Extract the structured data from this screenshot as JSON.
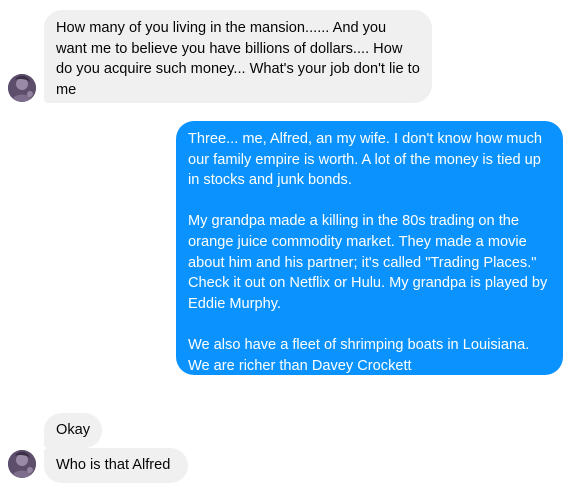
{
  "conversation": {
    "messages": [
      {
        "sender": "other",
        "text": "How many of you living in the mansion...... And you want me to believe you have billions of dollars.... How do you acquire such money... What's your job don't lie to me"
      },
      {
        "sender": "me",
        "text": "Three... me, Alfred, an my wife. I don't know how much our family empire is worth. A lot of the money is tied up in stocks and junk bonds.\n\nMy grandpa made a killing in the 80s trading on the orange juice commodity market. They made a movie about him and his partner; it's called \"Trading Places.\" Check it out on Netflix or Hulu. My grandpa is played by Eddie Murphy.\n\nWe also have a fleet of shrimping boats in Louisiana. We are richer than Davey Crockett"
      },
      {
        "sender": "other",
        "text": "Okay"
      },
      {
        "sender": "other",
        "text": "Who is that Alfred"
      }
    ]
  },
  "colors": {
    "incoming_bubble": "#f0f0f0",
    "outgoing_bubble": "#0a93ff",
    "incoming_text": "#050505",
    "outgoing_text": "#ffffff"
  },
  "icons": {
    "avatar": "contact-avatar-photo"
  }
}
